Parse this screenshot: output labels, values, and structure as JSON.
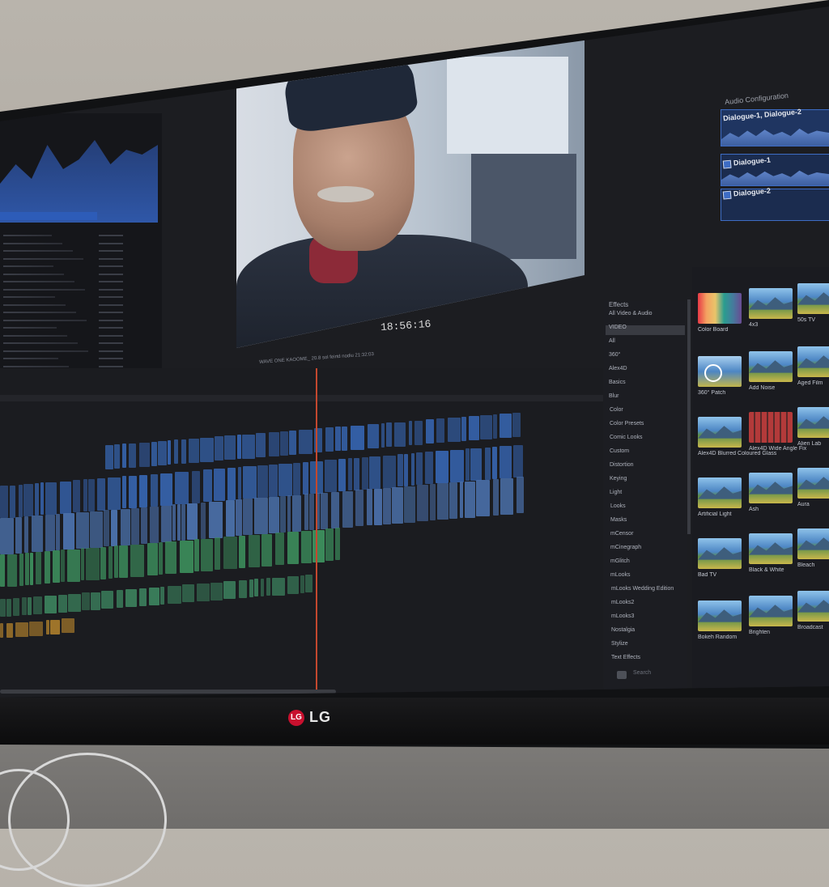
{
  "viewer": {
    "timecode": "18:56:16"
  },
  "timeline": {
    "header": "WAVE ONE KAOOME_ 20.8 sol feirtd nodiu   21:32:03"
  },
  "audio_config": {
    "title": "Audio Configuration",
    "lanes": [
      {
        "label": "Dialogue-1, Dialogue-2"
      },
      {
        "label": "Dialogue-1"
      },
      {
        "label": "Dialogue-2"
      }
    ]
  },
  "effects": {
    "title": "Effects",
    "categories": [
      "All Video & Audio",
      "VIDEO",
      "All",
      "360°",
      "Alex4D",
      "Basics",
      "Blur",
      "Color",
      "Color Presets",
      "Comic Looks",
      "Custom",
      "Distortion",
      "Keying",
      "Light",
      "Looks",
      "Masks",
      "mCensor",
      "mCinegraph",
      "mGlitch",
      "mLooks",
      "mLooks Wedding Edition",
      "mLooks2",
      "mLooks3",
      "Nostalgia",
      "Stylize",
      "Text Effects"
    ],
    "search_placeholder": "Search",
    "thumbnails": [
      "Color Board",
      "4x3",
      "50s TV",
      "360° Patch",
      "Add Noise",
      "Aged Film",
      "Alex4D Blurred Coloured Glass",
      "Alex4D Wide Angle Fix",
      "Alien Lab",
      "Artificial Light",
      "Ash",
      "Aura",
      "Bad TV",
      "Black & White",
      "Bleach",
      "Bokeh Random",
      "Brighten",
      "Broadcast"
    ]
  },
  "monitor": {
    "brand": "LG",
    "brand_mark": "LG"
  },
  "colors": {
    "accent_blue": "#2d5cb8",
    "playhead": "#c4482e",
    "clip_blue": "#3561a8",
    "clip_green": "#3b8a5a",
    "lg_red": "#c8102e"
  }
}
